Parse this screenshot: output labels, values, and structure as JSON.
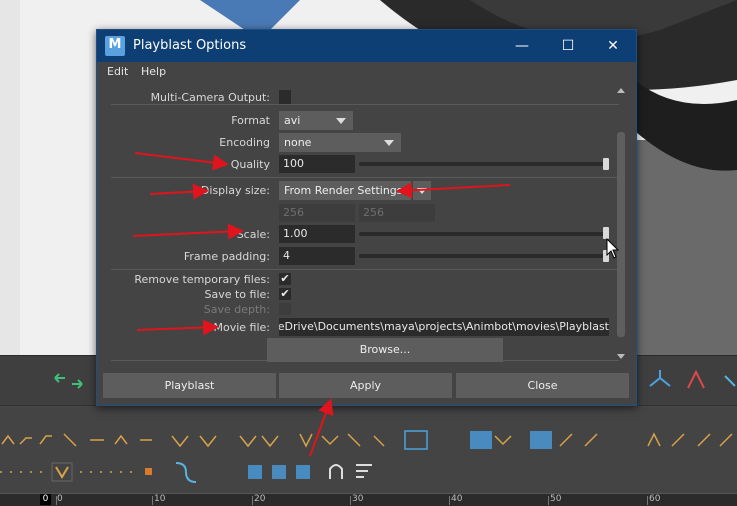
{
  "window": {
    "title": "Playblast Options",
    "app_icon": "M"
  },
  "menu": [
    "Edit",
    "Help"
  ],
  "window_controls": {
    "minimize": "—",
    "maximize": "☐",
    "close": "✕"
  },
  "form": {
    "multi_camera_label": "Multi-Camera Output:",
    "format_label": "Format",
    "format_value": "avi",
    "encoding_label": "Encoding",
    "encoding_value": "none",
    "quality_label": "Quality",
    "quality_value": "100",
    "quality_level": 1.0,
    "display_size_label": "Display size:",
    "display_size_value": "From Render Settings",
    "width_value": "256",
    "height_value": "256",
    "scale_label": "Scale:",
    "scale_value": "1.00",
    "scale_level": 1.0,
    "frame_padding_label": "Frame padding:",
    "frame_padding_value": "4",
    "remove_temp_label": "Remove temporary files:",
    "remove_temp_checked": true,
    "save_to_file_label": "Save to file:",
    "save_to_file_checked": true,
    "save_depth_label": "Save depth:",
    "save_depth_checked": false,
    "movie_file_label": "Movie file:",
    "movie_file_value": "r\\OneDrive\\Documents\\maya\\projects\\Animbot\\movies\\Playblast",
    "browse_label": "Browse..."
  },
  "buttons": {
    "playblast": "Playblast",
    "apply": "Apply",
    "close": "Close"
  },
  "check_mark": "✔",
  "timeline": {
    "current": "0",
    "ticks": [
      "0",
      "10",
      "20",
      "30",
      "40",
      "50",
      "60"
    ]
  },
  "colors": {
    "titlebar": "#0d3f74",
    "annotation_arrow": "#e0141c",
    "dialog_bg": "#444444"
  }
}
